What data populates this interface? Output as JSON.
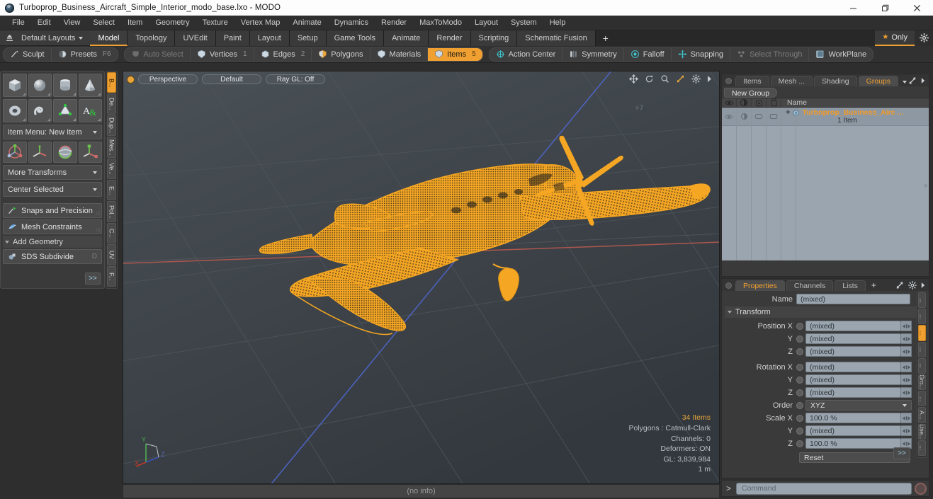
{
  "window": {
    "title": "Turboprop_Business_Aircraft_Simple_Interior_modo_base.lxo - MODO",
    "app_icon": "modo-sphere-icon",
    "minimize": "minimize-icon",
    "maximize": "restore-icon",
    "close": "close-icon"
  },
  "menu": {
    "items": [
      "File",
      "Edit",
      "View",
      "Select",
      "Item",
      "Geometry",
      "Texture",
      "Vertex Map",
      "Animate",
      "Dynamics",
      "Render",
      "MaxToModo",
      "Layout",
      "System",
      "Help"
    ]
  },
  "layoutbar": {
    "home_icon": "home-layout-icon",
    "layouts_label": "Default Layouts",
    "tabs": [
      {
        "label": "Model",
        "active": true
      },
      {
        "label": "Topology",
        "active": false
      },
      {
        "label": "UVEdit",
        "active": false
      },
      {
        "label": "Paint",
        "active": false
      },
      {
        "label": "Layout",
        "active": false
      },
      {
        "label": "Setup",
        "active": false
      },
      {
        "label": "Game Tools",
        "active": false
      },
      {
        "label": "Animate",
        "active": false
      },
      {
        "label": "Render",
        "active": false
      },
      {
        "label": "Scripting",
        "active": false
      },
      {
        "label": "Schematic Fusion",
        "active": false
      }
    ],
    "add_tab": "+",
    "only_label": "Only",
    "gear_icon": "gear-icon"
  },
  "modebar": {
    "left_group": [
      {
        "label": "Sculpt",
        "icon": "sculpt-brush-icon",
        "hotkey": "",
        "state": "normal"
      },
      {
        "label": "Presets",
        "icon": "presets-sphere-icon",
        "hotkey": "F6",
        "state": "normal"
      }
    ],
    "select_group": [
      {
        "label": "Auto Select",
        "icon": "autoselect-icon",
        "num": "",
        "state": "disabled"
      },
      {
        "label": "Vertices",
        "icon": "vertices-icon",
        "num": "1",
        "state": "normal"
      },
      {
        "label": "Edges",
        "icon": "edges-icon",
        "num": "2",
        "state": "normal"
      },
      {
        "label": "Polygons",
        "icon": "polygons-icon",
        "num": "",
        "state": "normal"
      },
      {
        "label": "Materials",
        "icon": "materials-icon",
        "num": "",
        "state": "normal"
      },
      {
        "label": "Items",
        "icon": "items-icon",
        "num": "5",
        "state": "active"
      }
    ],
    "right_group": [
      {
        "label": "Action Center",
        "icon": "action-center-icon",
        "state": "normal"
      },
      {
        "label": "Symmetry",
        "icon": "symmetry-icon",
        "state": "normal"
      },
      {
        "label": "Falloff",
        "icon": "falloff-icon",
        "state": "normal"
      },
      {
        "label": "Snapping",
        "icon": "snapping-icon",
        "state": "normal"
      },
      {
        "label": "Select Through",
        "icon": "select-through-icon",
        "state": "disabled"
      },
      {
        "label": "WorkPlane",
        "icon": "workplane-icon",
        "state": "normal"
      }
    ]
  },
  "toolpanel": {
    "primitives_row1": [
      "cube-primitive-icon",
      "sphere-primitive-icon",
      "cylinder-primitive-icon",
      "cone-primitive-icon"
    ],
    "primitives_row2": [
      "torus-primitive-icon",
      "spiral-primitive-icon",
      "prism-primitive-icon",
      "text-primitive-icon"
    ],
    "item_menu": "Item Menu: New Item",
    "transforms": [
      "move-transform-icon",
      "rotate-transform-icon",
      "scale-transform-icon",
      "transform-tool-icon"
    ],
    "more_transforms": "More Transforms",
    "center_selected": "Center Selected",
    "snaps": {
      "label": "Snaps and Precision",
      "icon": "snaps-icon"
    },
    "mesh_constraints": {
      "label": "Mesh Constraints",
      "icon": "mesh-constraints-icon"
    },
    "add_geometry": "Add Geometry",
    "sds_subdivide": {
      "label": "SDS Subdivide",
      "icon": "sds-icon",
      "hotkey": "D"
    },
    "expand": ">>",
    "vertical_tabs": [
      {
        "label": "B...",
        "active": true
      },
      {
        "label": "De...",
        "active": false
      },
      {
        "label": "Dup...",
        "active": false
      },
      {
        "label": "Mes...",
        "active": false
      },
      {
        "label": "Ve...",
        "active": false
      },
      {
        "label": "E...",
        "active": false
      },
      {
        "label": "Pol...",
        "active": false
      },
      {
        "label": "C...",
        "active": false
      },
      {
        "label": "UV",
        "active": false
      },
      {
        "label": "F...",
        "active": false
      }
    ]
  },
  "viewport": {
    "pills": [
      "Perspective",
      "Default",
      "Ray GL: Off"
    ],
    "tool_icons": [
      "pan-icon",
      "rotate-icon",
      "zoom-icon",
      "fit-icon",
      "viewport-gear-icon",
      "viewport-more-icon"
    ],
    "grid_marker": "+7",
    "info": {
      "items": "34 Items",
      "polygons": "Polygons : Catmull-Clark",
      "channels": "Channels: 0",
      "deformers": "Deformers: ON",
      "gl": "GL: 3,839,984",
      "scale": "1 m"
    },
    "gizmo": {
      "x": "X",
      "y": "Y",
      "z": "Z"
    },
    "model_name": "turboprop-business-aircraft-wireframe",
    "wire_color": "#f5a623",
    "background_color": "#3c4247"
  },
  "statusbar": {
    "text": "(no info)"
  },
  "groups_panel": {
    "tabs": [
      {
        "label": "Items",
        "active": false
      },
      {
        "label": "Mesh ...",
        "active": false
      },
      {
        "label": "Shading",
        "active": false
      },
      {
        "label": "Groups",
        "active": true
      }
    ],
    "dropdown_icon": "chevron-down-icon",
    "expand_icon": "expand-panel-icon",
    "more_icon": "panel-more-icon",
    "new_group_button": "New Group",
    "column_icons": [
      "eye-visibility-icon",
      "render-visibility-icon",
      "lock-icon",
      "selectable-icon"
    ],
    "name_column": "Name",
    "rows": [
      {
        "name": "Turboprop_Business_Airc ...",
        "sub": "1 Item",
        "icon": "group-sphere-icon",
        "expander": "+"
      }
    ]
  },
  "properties_panel": {
    "tabs": [
      {
        "label": "Properties",
        "active": true
      },
      {
        "label": "Channels",
        "active": false
      },
      {
        "label": "Lists",
        "active": false
      }
    ],
    "add_tab": "+",
    "expand_icon": "expand-panel-icon",
    "gear_icon": "gear-icon",
    "more_icon": "panel-more-icon",
    "name_label": "Name",
    "name_value": "(mixed)",
    "transform_section": "Transform",
    "fields": [
      {
        "label": "Position X",
        "value": "(mixed)"
      },
      {
        "label": "Y",
        "value": "(mixed)"
      },
      {
        "label": "Z",
        "value": "(mixed)"
      },
      {
        "label": "Rotation X",
        "value": "(mixed)"
      },
      {
        "label": "Y",
        "value": "(mixed)"
      },
      {
        "label": "Z",
        "value": "(mixed)"
      }
    ],
    "order_label": "Order",
    "order_value": "XYZ",
    "scale_fields": [
      {
        "label": "Scale X",
        "value": "100.0 %"
      },
      {
        "label": "Y",
        "value": "(mixed)"
      },
      {
        "label": "Z",
        "value": "100.0 %"
      }
    ],
    "reset_label": "Reset",
    "expand": ">>",
    "vertical_tabs": [
      {
        "label": "...",
        "active": false
      },
      {
        "label": "...",
        "active": false
      },
      {
        "label": "...",
        "active": true
      },
      {
        "label": "...",
        "active": false
      },
      {
        "label": "...",
        "active": false
      },
      {
        "label": "Gro...",
        "active": false
      },
      {
        "label": "...",
        "active": false
      },
      {
        "label": "A...",
        "active": false
      },
      {
        "label": "Use...",
        "active": false
      },
      {
        "label": "...",
        "active": false
      }
    ]
  },
  "command_bar": {
    "prompt": ">",
    "placeholder": "Command",
    "record_icon": "record-icon"
  },
  "colors": {
    "accent": "#f0a030",
    "wireframe": "#f5a623",
    "panel_bg": "#3a3a3a",
    "list_bg": "#9aa5af"
  }
}
